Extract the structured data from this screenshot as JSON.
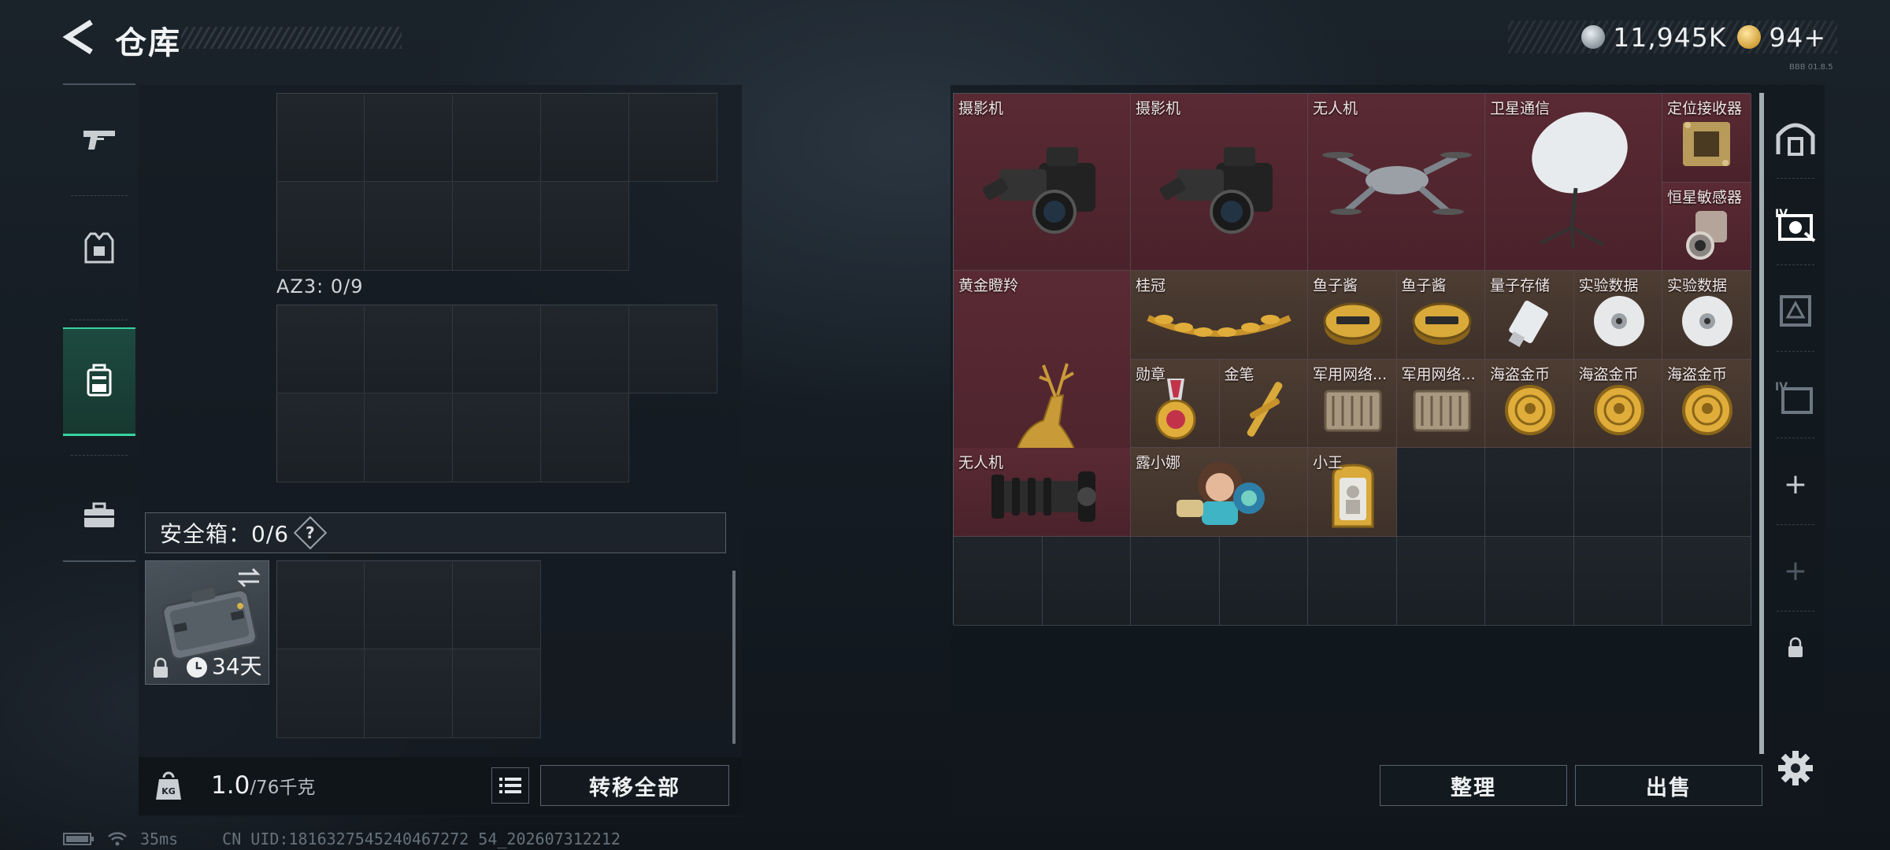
{
  "header": {
    "title": "仓库",
    "currency": [
      {
        "icon": "silver-coin-icon",
        "value": "11,945K"
      },
      {
        "icon": "gold-coin-icon",
        "value": "94+"
      }
    ],
    "corner_text": "BBB 01.8.5"
  },
  "left_rail": {
    "items": [
      {
        "icon": "gun-icon"
      },
      {
        "icon": "armor-vest-icon"
      },
      {
        "icon": "backpack-icon",
        "active": true
      },
      {
        "icon": "toolbox-icon"
      }
    ]
  },
  "storage": {
    "az3_label": "AZ3: 0/9",
    "safe_box": {
      "label": "安全箱：0/6",
      "help": "?",
      "days_left": "34天"
    }
  },
  "weight": {
    "icon_label": "KG",
    "current": "1.0",
    "max": "/76千克"
  },
  "buttons": {
    "transfer_all": "转移全部",
    "sort": "整理",
    "sell": "出售"
  },
  "items": [
    {
      "name": "摄影机",
      "color": "red",
      "icon": "camera-icon"
    },
    {
      "name": "摄影机",
      "color": "red",
      "icon": "camera-icon"
    },
    {
      "name": "无人机",
      "color": "red",
      "icon": "drone-icon"
    },
    {
      "name": "卫星通信",
      "color": "red",
      "icon": "satellite-dish-icon"
    },
    {
      "name": "定位接收器",
      "color": "red",
      "icon": "receiver-icon"
    },
    {
      "name": "恒星敏感器",
      "color": "red",
      "icon": "star-sensor-icon"
    },
    {
      "name": "黄金瞪羚",
      "color": "red",
      "icon": "golden-gazelle-icon"
    },
    {
      "name": "桂冠",
      "color": "brown",
      "icon": "laurel-crown-icon"
    },
    {
      "name": "鱼子酱",
      "color": "brown",
      "icon": "caviar-tin-icon"
    },
    {
      "name": "鱼子酱",
      "color": "brown",
      "icon": "caviar-tin-icon"
    },
    {
      "name": "量子存储",
      "color": "brown",
      "icon": "usb-drive-icon"
    },
    {
      "name": "实验数据",
      "color": "brown",
      "icon": "disc-icon"
    },
    {
      "name": "实验数据",
      "color": "brown",
      "icon": "disc-icon"
    },
    {
      "name": "勋章",
      "color": "brown",
      "icon": "medal-icon"
    },
    {
      "name": "金笔",
      "color": "brown",
      "icon": "gold-pen-icon"
    },
    {
      "name": "军用网络...",
      "color": "brown",
      "icon": "network-module-icon"
    },
    {
      "name": "军用网络...",
      "color": "brown",
      "icon": "network-module-icon"
    },
    {
      "name": "海盗金币",
      "color": "brown",
      "icon": "pirate-coin-icon"
    },
    {
      "name": "海盗金币",
      "color": "brown",
      "icon": "pirate-coin-icon"
    },
    {
      "name": "海盗金币",
      "color": "brown",
      "icon": "pirate-coin-icon"
    },
    {
      "name": "无人机",
      "color": "red",
      "icon": "drone-engine-icon"
    },
    {
      "name": "露小娜",
      "color": "brown",
      "icon": "doll-icon"
    },
    {
      "name": "小王",
      "color": "brown",
      "icon": "card-icon"
    }
  ],
  "status": {
    "ping": "35ms",
    "uid": "CN UID:1816327545240467272 54_202607312212"
  },
  "colors": {
    "accent": "#38d39f",
    "item_red": "#5a2a34",
    "item_brown": "#4d3d33"
  }
}
